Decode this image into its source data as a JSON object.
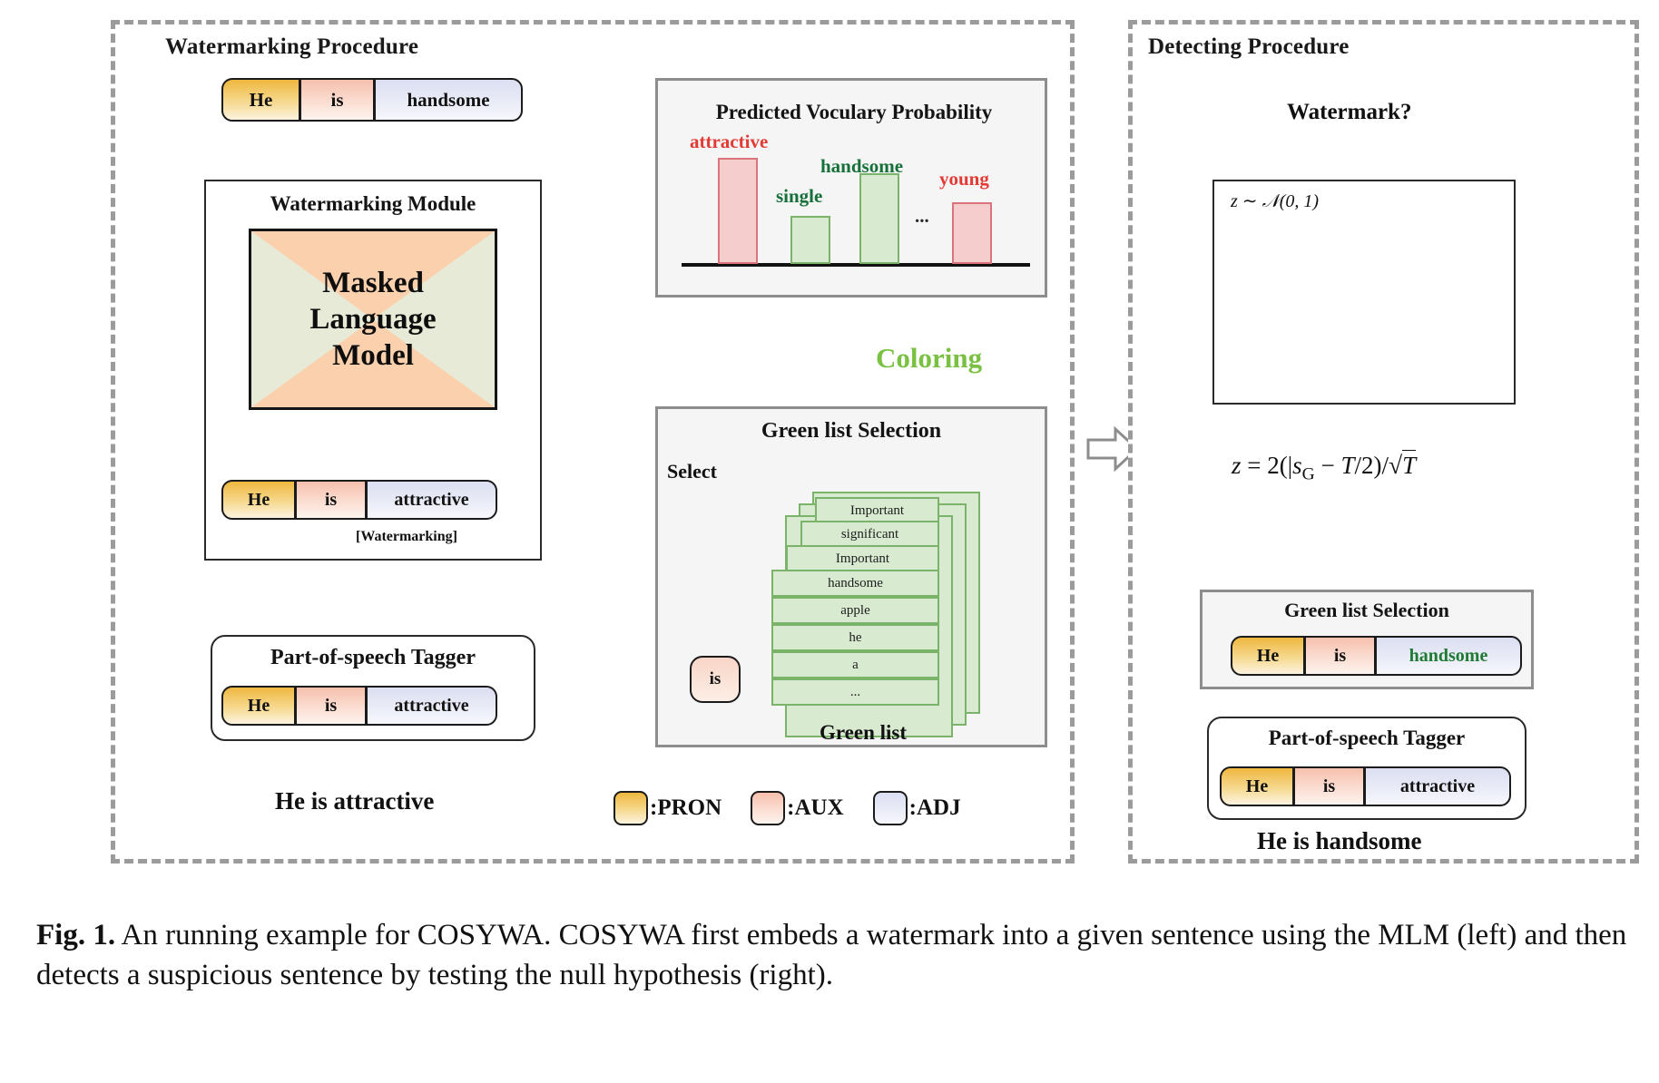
{
  "figure": {
    "caption_label": "Fig. 1.",
    "caption_text": " An running example for COSYWA. COSYWA first embeds a watermark into a given sentence using the MLM (left) and then detects a suspicious sentence by testing the null hypothesis (right)."
  },
  "colors": {
    "pron": "#efb73e",
    "aux": "#f6c0ad",
    "adj": "#dcdff2",
    "green_list": "#d8ead0",
    "green_border": "#7cb36a",
    "red_bar": "#f5cdcd",
    "red_border": "#d9747a",
    "red_text": "#e23a34",
    "green_text": "#17703a",
    "coloring_text": "#7ac143",
    "panel_dash": "#9b9b9b",
    "curve": "#4a7ebb",
    "curve_fill": "#d9e7cf",
    "curve_tail": "#f2b9b9"
  },
  "left_panel": {
    "title": "Watermarking Procedure",
    "output_tokens": [
      {
        "text": "He",
        "pos": "pron"
      },
      {
        "text": "is",
        "pos": "aux"
      },
      {
        "text": "handsome",
        "pos": "adj"
      }
    ],
    "watermarking_module": {
      "title": "Watermarking Module",
      "model_name_lines": [
        "Masked",
        "Language",
        "Model"
      ],
      "input_tokens": [
        {
          "text": "He",
          "pos": "pron"
        },
        {
          "text": "is",
          "pos": "aux"
        },
        {
          "text": "attractive",
          "pos": "adj"
        }
      ],
      "note": "[Watermarking]"
    },
    "pos_tagger": {
      "title": "Part-of-speech Tagger",
      "tokens": [
        {
          "text": "He",
          "pos": "pron"
        },
        {
          "text": "is",
          "pos": "aux"
        },
        {
          "text": "attractive",
          "pos": "adj"
        }
      ]
    },
    "input_sentence": "He is attractive"
  },
  "middle": {
    "coloring_label": "Coloring",
    "green_list_selection": {
      "title": "Green list Selection",
      "select_label": "Select",
      "token_bubble": "is",
      "bottom_label": "Green list",
      "list_items": [
        "Important",
        "significant",
        "Important",
        "handsome",
        "apple",
        "he",
        "a",
        "..."
      ]
    }
  },
  "chart_data": {
    "type": "bar",
    "title": "Predicted Voculary Probability",
    "categories": [
      "attractive",
      "single",
      "handsome",
      "...",
      "young"
    ],
    "values": [
      100,
      45,
      85,
      0,
      58
    ],
    "bar_colors": [
      "red",
      "green",
      "green",
      "none",
      "red"
    ],
    "labels": [
      "attractive",
      "single",
      "handsome",
      "...",
      "young"
    ],
    "label_colors": [
      "red",
      "green",
      "green",
      "none",
      "red"
    ],
    "xlabel": "",
    "ylabel": "",
    "ylim": [
      0,
      120
    ],
    "grid": false,
    "legend": "none",
    "ellipsis_marker": "..."
  },
  "right_panel": {
    "title": "Detecting Procedure",
    "decision": "Watermark?",
    "distribution": {
      "annotation": "z ~ N(0, 1)"
    },
    "z_formula": "z = 2(|s|_G - T/2)/√T",
    "green_list_selection": {
      "title": "Green list Selection",
      "tokens": [
        {
          "text": "He",
          "pos": "pron"
        },
        {
          "text": "is",
          "pos": "aux"
        },
        {
          "text": "handsome",
          "pos": "adj",
          "green": true
        }
      ]
    },
    "pos_tagger": {
      "title": "Part-of-speech Tagger",
      "tokens": [
        {
          "text": "He",
          "pos": "pron"
        },
        {
          "text": "is",
          "pos": "aux"
        },
        {
          "text": "attractive",
          "pos": "adj"
        }
      ]
    },
    "input_sentence": "He is handsome"
  },
  "legend": [
    {
      "swatch": "pron",
      "label": ":PRON"
    },
    {
      "swatch": "aux",
      "label": ":AUX"
    },
    {
      "swatch": "adj",
      "label": ":ADJ"
    }
  ]
}
